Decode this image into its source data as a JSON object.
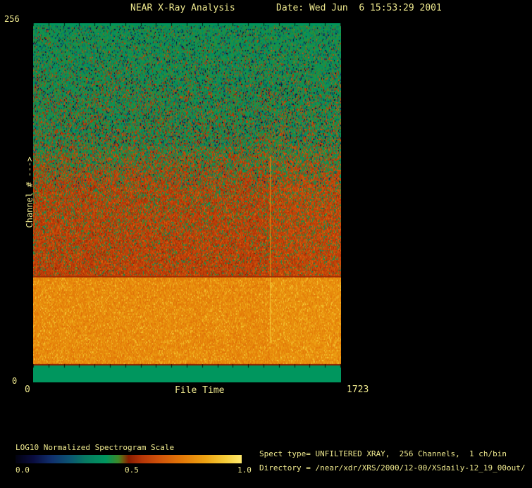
{
  "header": {
    "title": "NEAR X-Ray Analysis",
    "date_label": "Date: Wed Jun  6 15:53:29 2001"
  },
  "plot": {
    "y_axis": {
      "max_label": "256",
      "min_label": "0",
      "title": "Channel # --->"
    },
    "x_axis": {
      "min_label": "0",
      "title": "File Time",
      "max_label": "1723"
    }
  },
  "colorbar": {
    "title": "LOG10 Normalized Spectrogram Scale",
    "tick_labels": [
      "0.0",
      "0.5",
      "1.0"
    ]
  },
  "info": {
    "spect_type_line": "Spect type= UNFILTERED XRAY,  256 Channels,  1 ch/bin",
    "directory_line": "Directory = /near/xdr/XRS/2000/12-00/XSdaily-12_19_00out/"
  },
  "colors": {
    "background": "#000000",
    "text": "#efe98e",
    "solid_green": "#009963",
    "red_zone": "#c54409",
    "orange_zone": "#e88c0c",
    "tick": "#000000"
  },
  "chart_data": {
    "type": "heatmap",
    "title": "NEAR X-Ray Analysis",
    "xlabel": "File Time",
    "ylabel": "Channel # --->",
    "xlim": [
      0,
      1723
    ],
    "ylim": [
      0,
      256
    ],
    "colorbar": {
      "label": "LOG10 Normalized Spectrogram Scale",
      "range": [
        0.0,
        1.0
      ],
      "ticks": [
        0.0,
        0.5,
        1.0
      ],
      "position": "bottom-left"
    },
    "channel_bands": [
      {
        "channels": [
          0,
          13
        ],
        "appearance": "uniform solid green",
        "approx_value": 0.4
      },
      {
        "channels": [
          13,
          75
        ],
        "appearance": "bright orange speckled band",
        "approx_value": 0.78
      },
      {
        "channels": [
          75,
          152
        ],
        "appearance": "brick red speckled with green",
        "approx_value": 0.59
      },
      {
        "channels": [
          152,
          190
        ],
        "appearance": "green-to-red transition",
        "approx_value": 0.5
      },
      {
        "channels": [
          190,
          255
        ],
        "appearance": "green with dark navy speckles",
        "approx_value": 0.41
      },
      {
        "channels": [
          255,
          256
        ],
        "appearance": "uniform solid green top edge",
        "approx_value": 0.4
      }
    ],
    "event_line": {
      "file_time": 1325,
      "x_frac": 0.77,
      "y_frac": [
        0.37,
        0.89
      ],
      "v_red_zone": 0.8,
      "v_orange_zone": 0.93
    },
    "right_shift": {
      "x_frac": 0.77,
      "dv": 0.015
    },
    "palette_stops": [
      [
        0.0,
        "#020210"
      ],
      [
        0.08,
        "#0a0d40"
      ],
      [
        0.16,
        "#10306e"
      ],
      [
        0.24,
        "#0c5572"
      ],
      [
        0.31,
        "#077a62"
      ],
      [
        0.4,
        "#00965e"
      ],
      [
        0.455,
        "#3d8a28"
      ],
      [
        0.475,
        "#6b5a10"
      ],
      [
        0.5,
        "#871c00"
      ],
      [
        0.56,
        "#b63608"
      ],
      [
        0.64,
        "#d1540a"
      ],
      [
        0.74,
        "#e47a08"
      ],
      [
        0.84,
        "#eda313"
      ],
      [
        0.93,
        "#f6cd3a"
      ],
      [
        1.0,
        "#ffe96e"
      ]
    ],
    "zones": [
      {
        "y": [
          0.0,
          0.006
        ],
        "kind": "solid",
        "v": 0.4
      },
      {
        "y": [
          0.006,
          0.343
        ],
        "kind": "speckle",
        "base": 0.41,
        "jit": 0.05,
        "mix": [
          {
            "p": [
              0.1,
              0.09
            ],
            "v": [
              0.03,
              0.26
            ]
          },
          {
            "p": [
              0.07,
              0.05
            ],
            "v": [
              0.27,
              0.35
            ]
          },
          {
            "p": [
              0.02,
              0.3
            ],
            "v": [
              0.52,
              0.63
            ]
          }
        ]
      },
      {
        "y": [
          0.343,
          0.459
        ],
        "kind": "speckle",
        "base": 0.41,
        "jit": 0.05,
        "mix": [
          {
            "p": [
              0.05,
              0.03
            ],
            "v": [
              0.05,
              0.3
            ]
          },
          {
            "p": [
              0.34,
              0.74
            ],
            "v": [
              0.53,
              0.64
            ]
          }
        ]
      },
      {
        "y": [
          0.459,
          0.704
        ],
        "kind": "speckle",
        "base": 0.585,
        "jit": 0.045,
        "mix": [
          {
            "p": [
              0.26,
              0.1
            ],
            "v": [
              0.37,
              0.47
            ]
          },
          {
            "p": [
              0.05,
              0.07
            ],
            "v": [
              0.65,
              0.7
            ]
          },
          {
            "p": [
              0.04,
              0.04
            ],
            "v": [
              0.5,
              0.53
            ]
          }
        ]
      },
      {
        "y": [
          0.704,
          0.708
        ],
        "kind": "solid",
        "v": 0.53
      },
      {
        "y": [
          0.708,
          0.949
        ],
        "kind": "speckle",
        "base": 0.78,
        "jit": 0.045,
        "mix": [
          {
            "p": [
              0.1,
              0.12
            ],
            "v": [
              0.85,
              0.92
            ]
          },
          {
            "p": [
              0.1,
              0.1
            ],
            "v": [
              0.7,
              0.74
            ]
          }
        ]
      },
      {
        "y": [
          0.949,
          0.953
        ],
        "kind": "solid",
        "v": 0.5
      },
      {
        "y": [
          0.953,
          1.0
        ],
        "kind": "solid",
        "v": 0.4
      }
    ],
    "x_ticks": {
      "intervals": 20,
      "top_len": 4,
      "bottom_y_frac": 0.949,
      "bottom_len": 5
    }
  }
}
